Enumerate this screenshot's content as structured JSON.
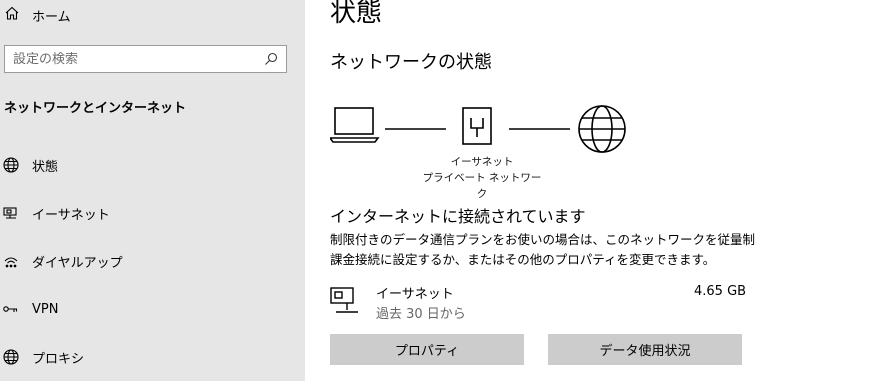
{
  "sidebar": {
    "home_label": "ホーム",
    "search_placeholder": "設定の検索",
    "section_title": "ネットワークとインターネット",
    "items": [
      {
        "label": "状態",
        "icon": "globe-icon"
      },
      {
        "label": "イーサネット",
        "icon": "ethernet-icon"
      },
      {
        "label": "ダイヤルアップ",
        "icon": "dialup-icon"
      },
      {
        "label": "VPN",
        "icon": "vpn-icon"
      },
      {
        "label": "プロキシ",
        "icon": "globe-icon"
      }
    ]
  },
  "main": {
    "title": "状態",
    "network_status_heading": "ネットワークの状態",
    "diagram": {
      "caption_line1": "イーサネット",
      "caption_line2": "プライベート ネットワーク"
    },
    "connection_heading": "インターネットに接続されています",
    "connection_description": "制限付きのデータ通信プランをお使いの場合は、このネットワークを従量制課金接続に設定するか、またはその他のプロパティを変更できます。",
    "adapter": {
      "name": "イーサネット",
      "period": "過去 30 日から",
      "usage": "4.65 GB"
    },
    "buttons": {
      "properties": "プロパティ",
      "data_usage": "データ使用状況"
    }
  },
  "colors": {
    "sidebar_bg": "#e6e6e6",
    "button_bg": "#cccccc"
  }
}
